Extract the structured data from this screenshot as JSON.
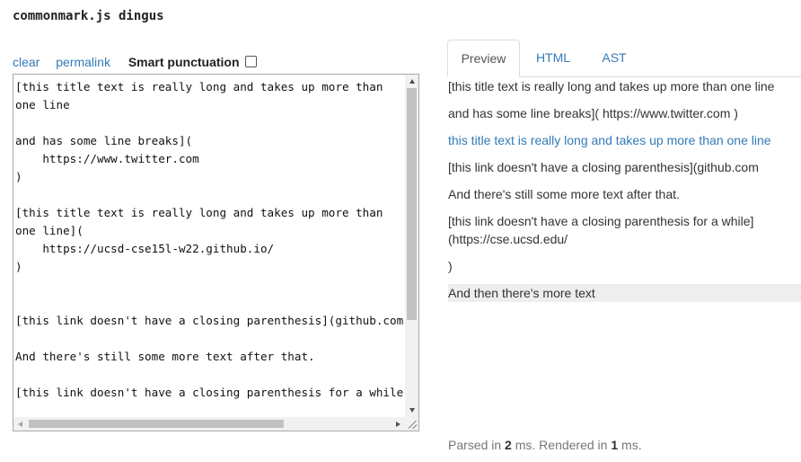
{
  "app": {
    "title": "commonmark.js dingus"
  },
  "toolbar": {
    "clear": "clear",
    "permalink": "permalink",
    "smart_punctuation": "Smart punctuation",
    "smart_punctuation_checked": false
  },
  "editor": {
    "text": "[this title text is really long and takes up more than\none line\n\nand has some line breaks](\n    https://www.twitter.com\n)\n\n[this title text is really long and takes up more than\none line](\n    https://ucsd-cse15l-w22.github.io/\n)\n\n\n[this link doesn't have a closing parenthesis](github.com\n\nAnd there's still some more text after that.\n\n[this link doesn't have a closing parenthesis for a while"
  },
  "tabs": [
    {
      "label": "Preview",
      "active": true
    },
    {
      "label": "HTML",
      "active": false
    },
    {
      "label": "AST",
      "active": false
    }
  ],
  "preview": {
    "p1_line1": "[this title text is really long and takes up more than one line",
    "p1_line2": "and has some line breaks]( https://www.twitter.com )",
    "link1": "this title text is really long and takes up more than one line",
    "p3": "[this link doesn't have a closing parenthesis](github.com",
    "p4": "And there's still some more text after that.",
    "p5_line1": "[this link doesn't have a closing parenthesis for a while]",
    "p5_line2": "(https://cse.ucsd.edu/",
    "p6": ")",
    "p7": "And then there's more text"
  },
  "timing": {
    "parsed_prefix": "Parsed in",
    "parsed_ms": "2",
    "rendered_prefix": "ms. Rendered in",
    "rendered_ms": "1",
    "suffix": "ms."
  }
}
